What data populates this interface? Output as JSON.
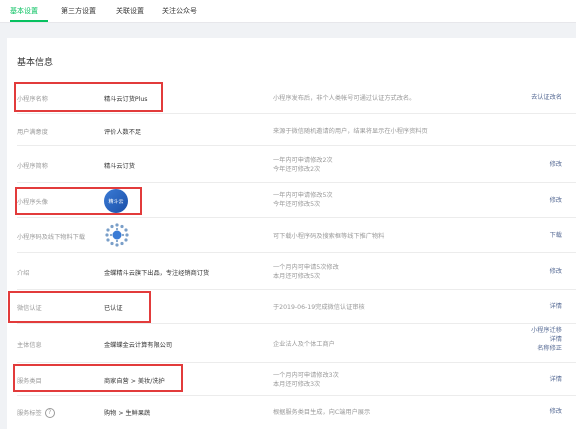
{
  "tabs": [
    "基本设置",
    "第三方设置",
    "关联设置",
    "关注公众号"
  ],
  "section_title": "基本信息",
  "rows": [
    {
      "label": "小程序名称",
      "value": "精斗云订货Plus",
      "desc": [
        "小程序发布后，非个人类帐号可通过认证方式改名。"
      ],
      "actions": [
        "去认证改名"
      ]
    },
    {
      "label": "用户满意度",
      "value": "评价人数不足",
      "desc": [
        "来源于微信随机邀请的用户，结果将显示在小程序资料页"
      ],
      "actions": []
    },
    {
      "label": "小程序简称",
      "value": "精斗云订货",
      "desc": [
        "一年内可申请修改2次",
        "今年还可修改2次"
      ],
      "actions": [
        "修改"
      ]
    },
    {
      "label": "小程序头像",
      "value": "",
      "avatar_text": "精斗云",
      "desc": [
        "一年内可申请修改5次",
        "今年还可修改5次"
      ],
      "actions": [
        "修改"
      ]
    },
    {
      "label": "小程序码及线下物料下载",
      "value": "",
      "desc": [
        "可下载小程序码及搜索框等线下推广物料"
      ],
      "actions": [
        "下载"
      ]
    },
    {
      "label": "介绍",
      "value": "金蝶精斗云旗下出品，专注经销商订货",
      "desc": [
        "一个月内可申请5次修改",
        "本月还可修改5次"
      ],
      "actions": [
        "修改"
      ]
    },
    {
      "label": "微信认证",
      "value": "已认证",
      "desc": [
        "于2019-06-19完成微信认证审核"
      ],
      "actions": [
        "详情"
      ]
    },
    {
      "label": "主体信息",
      "value": "金蝶蝶金云计算有限公司",
      "desc": [
        "企业法人及个体工商户"
      ],
      "actions": [
        "小程序迁移",
        "详情",
        "名称修正"
      ]
    },
    {
      "label": "服务类目",
      "value": "商家自营 > 美妆/洗护",
      "desc": [
        "一个月内可申请修改3次",
        "本月还可修改3次"
      ],
      "actions": [
        "详情"
      ]
    },
    {
      "label": "服务标签",
      "value": "购物 > 生鲜果蔬",
      "desc": [
        "根据服务类目生成，向C端用户展示"
      ],
      "actions": [
        "修改"
      ],
      "help": "?"
    }
  ],
  "colors": {
    "accent": "#07c160",
    "link": "#576b95",
    "highlight": "#e23b3b"
  }
}
